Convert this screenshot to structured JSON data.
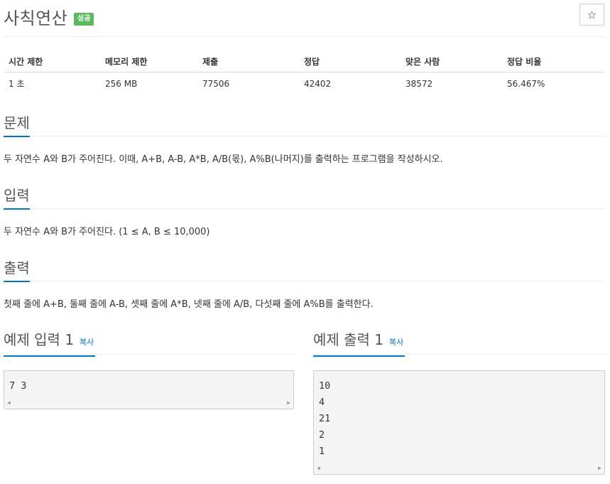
{
  "problem": {
    "title": "사칙연산",
    "status_badge": "성공",
    "star_icon": "☆"
  },
  "info": {
    "headers": [
      "시간 제한",
      "메모리 제한",
      "제출",
      "정답",
      "맞은 사람",
      "정답 비율"
    ],
    "values": [
      "1 초",
      "256 MB",
      "77506",
      "42402",
      "38572",
      "56.467%"
    ]
  },
  "sections": {
    "problem": {
      "heading": "문제",
      "text": "두 자연수 A와 B가 주어진다. 이때, A+B, A-B, A*B, A/B(몫), A%B(나머지)를 출력하는 프로그램을 작성하시오."
    },
    "input": {
      "heading": "입력",
      "text": "두 자연수 A와 B가 주어진다. (1 ≤ A, B ≤ 10,000)"
    },
    "output": {
      "heading": "출력",
      "text": "첫째 줄에 A+B, 둘째 줄에 A-B, 셋째 줄에 A*B, 넷째 줄에 A/B, 다섯째 줄에 A%B를 출력한다."
    }
  },
  "samples": {
    "input": {
      "heading": "예제 입력 1",
      "copy_label": "복사",
      "content": "7 3"
    },
    "output": {
      "heading": "예제 출력 1",
      "copy_label": "복사",
      "content": "10\n4\n21\n2\n1"
    }
  },
  "colors": {
    "accent": "#0076c0",
    "success": "#5cb85c",
    "code_bg": "#f5f5f5"
  }
}
